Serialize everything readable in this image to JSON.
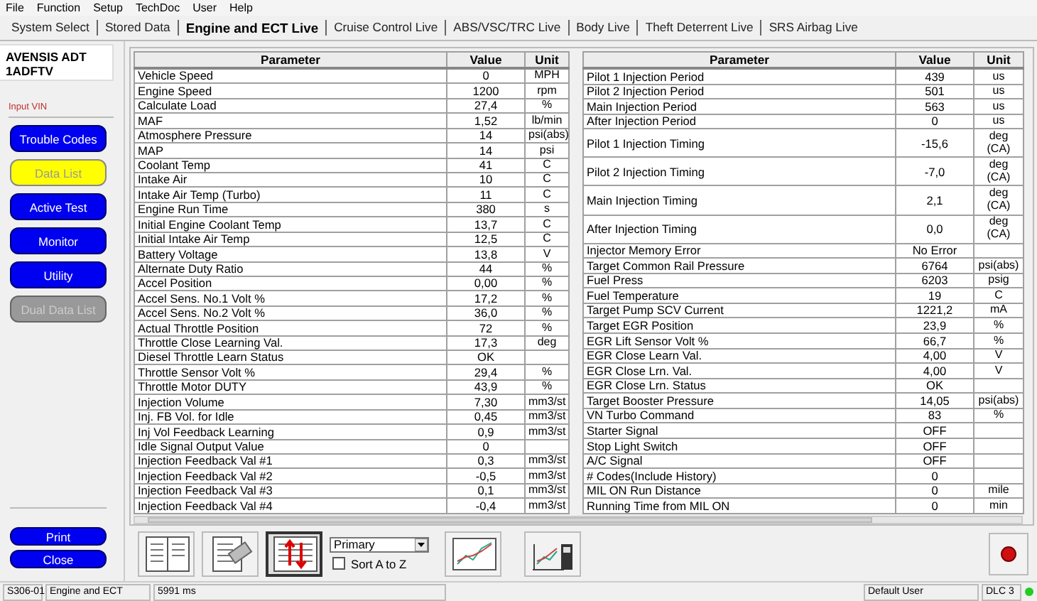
{
  "menu": [
    "File",
    "Function",
    "Setup",
    "TechDoc",
    "User",
    "Help"
  ],
  "tabs": [
    {
      "label": "System Select",
      "selected": false
    },
    {
      "label": "Stored Data",
      "selected": false
    },
    {
      "label": "Engine and ECT Live",
      "selected": true
    },
    {
      "label": "Cruise Control Live",
      "selected": false
    },
    {
      "label": "ABS/VSC/TRC Live",
      "selected": false
    },
    {
      "label": "Body Live",
      "selected": false
    },
    {
      "label": "Theft Deterrent Live",
      "selected": false
    },
    {
      "label": "SRS Airbag Live",
      "selected": false
    }
  ],
  "vehicle": {
    "model": "AVENSIS ADT",
    "engine": "1ADFTV"
  },
  "input_vin_link": "Input VIN",
  "nav_buttons": [
    {
      "label": "Trouble Codes",
      "selected": false,
      "disabled": false
    },
    {
      "label": "Data List",
      "selected": true,
      "disabled": false
    },
    {
      "label": "Active Test",
      "selected": false,
      "disabled": false
    },
    {
      "label": "Monitor",
      "selected": false,
      "disabled": false
    },
    {
      "label": "Utility",
      "selected": false,
      "disabled": false
    },
    {
      "label": "Dual Data List",
      "selected": false,
      "disabled": true
    }
  ],
  "bottom_buttons": [
    "Print",
    "Close"
  ],
  "tables": [
    {
      "columns": [
        "Parameter",
        "Value",
        "Unit"
      ],
      "rows": [
        {
          "parameter": "Vehicle Speed",
          "value": "0",
          "unit": "MPH"
        },
        {
          "parameter": "Engine Speed",
          "value": "1200",
          "unit": "rpm"
        },
        {
          "parameter": "Calculate Load",
          "value": "27,4",
          "unit": "%"
        },
        {
          "parameter": "MAF",
          "value": "1,52",
          "unit": "lb/min"
        },
        {
          "parameter": "Atmosphere Pressure",
          "value": "14",
          "unit": "psi(abs)"
        },
        {
          "parameter": "MAP",
          "value": "14",
          "unit": "psi"
        },
        {
          "parameter": "Coolant Temp",
          "value": "41",
          "unit": "C"
        },
        {
          "parameter": "Intake Air",
          "value": "10",
          "unit": "C"
        },
        {
          "parameter": "Intake Air Temp (Turbo)",
          "value": "11",
          "unit": "C"
        },
        {
          "parameter": "Engine Run Time",
          "value": "380",
          "unit": "s"
        },
        {
          "parameter": "Initial Engine Coolant Temp",
          "value": "13,7",
          "unit": "C"
        },
        {
          "parameter": "Initial Intake Air Temp",
          "value": "12,5",
          "unit": "C"
        },
        {
          "parameter": "Battery Voltage",
          "value": "13,8",
          "unit": "V"
        },
        {
          "parameter": "Alternate Duty Ratio",
          "value": "44",
          "unit": "%"
        },
        {
          "parameter": "Accel Position",
          "value": "0,00",
          "unit": "%"
        },
        {
          "parameter": "Accel Sens. No.1 Volt %",
          "value": "17,2",
          "unit": "%"
        },
        {
          "parameter": "Accel Sens. No.2 Volt %",
          "value": "36,0",
          "unit": "%"
        },
        {
          "parameter": "Actual Throttle Position",
          "value": "72",
          "unit": "%"
        },
        {
          "parameter": "Throttle Close Learning Val.",
          "value": "17,3",
          "unit": "deg"
        },
        {
          "parameter": "Diesel Throttle Learn Status",
          "value": "OK"
        },
        {
          "parameter": "Throttle Sensor Volt %",
          "value": "29,4",
          "unit": "%"
        },
        {
          "parameter": "Throttle Motor DUTY",
          "value": "43,9",
          "unit": "%"
        },
        {
          "parameter": "Injection Volume",
          "value": "7,30",
          "unit": "mm3/st"
        },
        {
          "parameter": "Inj. FB Vol. for Idle",
          "value": "0,45",
          "unit": "mm3/st"
        },
        {
          "parameter": "Inj Vol Feedback Learning",
          "value": "0,9",
          "unit": "mm3/st"
        },
        {
          "parameter": "Idle Signal Output Value",
          "value": "0"
        },
        {
          "parameter": "Injection Feedback Val #1",
          "value": "0,3",
          "unit": "mm3/st"
        },
        {
          "parameter": "Injection Feedback Val #2",
          "value": "-0,5",
          "unit": "mm3/st"
        },
        {
          "parameter": "Injection Feedback Val #3",
          "value": "0,1",
          "unit": "mm3/st"
        },
        {
          "parameter": "Injection Feedback Val #4",
          "value": "-0,4",
          "unit": "mm3/st"
        }
      ]
    },
    {
      "columns": [
        "Parameter",
        "Value",
        "Unit"
      ],
      "rows": [
        {
          "parameter": "Pilot 1 Injection Period",
          "value": "439",
          "unit": "us"
        },
        {
          "parameter": "Pilot 2 Injection Period",
          "value": "501",
          "unit": "us"
        },
        {
          "parameter": "Main Injection Period",
          "value": "563",
          "unit": "us"
        },
        {
          "parameter": "After Injection Period",
          "value": "0",
          "unit": "us"
        },
        {
          "parameter": "Pilot 1 Injection Timing",
          "value": "-15,6",
          "unit": "deg (CA)"
        },
        {
          "parameter": "Pilot 2 Injection Timing",
          "value": "-7,0",
          "unit": "deg (CA)"
        },
        {
          "parameter": "Main Injection Timing",
          "value": "2,1",
          "unit": "deg (CA)"
        },
        {
          "parameter": "After Injection Timing",
          "value": "0,0",
          "unit": "deg (CA)"
        },
        {
          "parameter": "Injector Memory Error",
          "value": "No Error"
        },
        {
          "parameter": "Target Common Rail Pressure",
          "value": "6764",
          "unit": "psi(abs)"
        },
        {
          "parameter": "Fuel Press",
          "value": "6203",
          "unit": "psig"
        },
        {
          "parameter": "Fuel Temperature",
          "value": "19",
          "unit": "C"
        },
        {
          "parameter": "Target Pump SCV Current",
          "value": "1221,2",
          "unit": "mA"
        },
        {
          "parameter": "Target EGR Position",
          "value": "23,9",
          "unit": "%"
        },
        {
          "parameter": "EGR Lift Sensor Volt %",
          "value": "66,7",
          "unit": "%"
        },
        {
          "parameter": "EGR Close Learn Val.",
          "value": "4,00",
          "unit": "V"
        },
        {
          "parameter": "EGR Close Lrn. Val.",
          "value": "4,00",
          "unit": "V"
        },
        {
          "parameter": "EGR Close Lrn. Status",
          "value": "OK"
        },
        {
          "parameter": "Target Booster Pressure",
          "value": "14,05",
          "unit": "psi(abs)"
        },
        {
          "parameter": "VN Turbo Command",
          "value": "83",
          "unit": "%"
        },
        {
          "parameter": "Starter Signal",
          "value": "OFF"
        },
        {
          "parameter": "Stop Light Switch",
          "value": "OFF"
        },
        {
          "parameter": "A/C Signal",
          "value": "OFF"
        },
        {
          "parameter": "# Codes(Include History)",
          "value": "0"
        },
        {
          "parameter": "MIL ON Run Distance",
          "value": "0",
          "unit": "mile"
        },
        {
          "parameter": "Running Time from MIL ON",
          "value": "0",
          "unit": "min"
        }
      ]
    }
  ],
  "toolbar_buttons": [
    {
      "selected": false
    },
    {
      "selected": false
    },
    {
      "selected": true
    },
    {
      "selected": false
    },
    {
      "selected": false
    }
  ],
  "list_select": {
    "value": "Primary"
  },
  "sort_checkbox": {
    "label": "Sort A to Z",
    "checked": false
  },
  "status_bar": [
    "S306-01",
    "Engine and ECT",
    "5991 ms",
    "Default User",
    "DLC 3"
  ]
}
